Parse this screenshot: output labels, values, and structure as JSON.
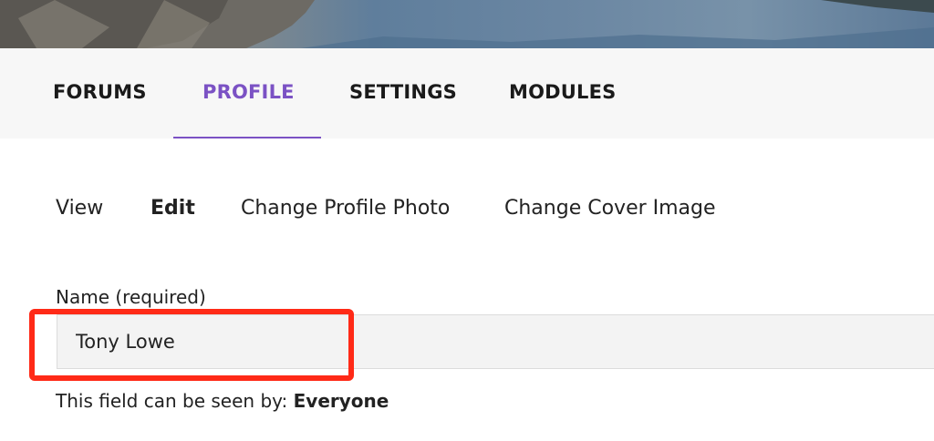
{
  "nav_tabs": [
    {
      "label": "FORUMS",
      "active": false
    },
    {
      "label": "PROFILE",
      "active": true
    },
    {
      "label": "SETTINGS",
      "active": false
    },
    {
      "label": "MODULES",
      "active": false
    }
  ],
  "sub_nav": [
    {
      "label": "View",
      "current": false
    },
    {
      "label": "Edit",
      "current": true
    },
    {
      "label": "Change Profile Photo",
      "current": false
    },
    {
      "label": "Change Cover Image",
      "current": false
    }
  ],
  "name_field": {
    "label": "Name (required)",
    "value": "Tony Lowe",
    "visibility_prefix": "This field can be seen by:",
    "visibility_value": "Everyone"
  },
  "colors": {
    "accent": "#7b52c4",
    "highlight": "#ff2a17"
  }
}
